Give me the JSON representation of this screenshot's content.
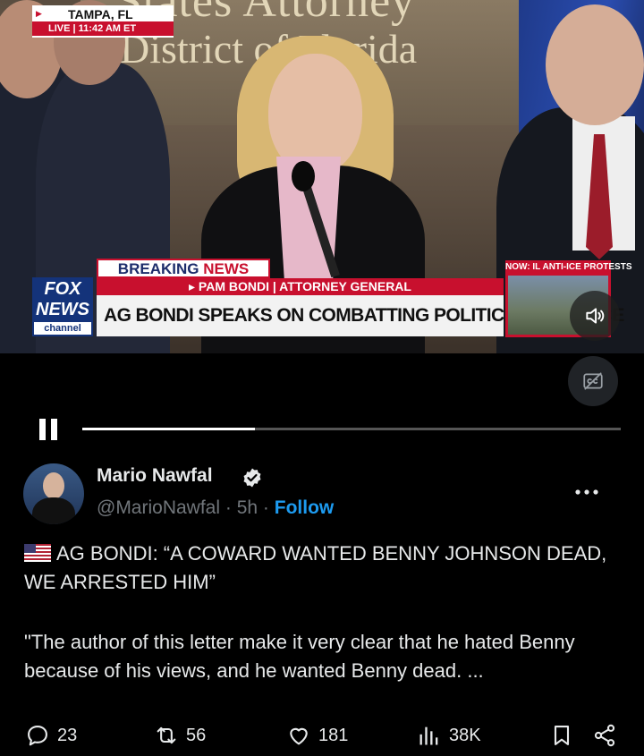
{
  "video": {
    "backdrop_line1": "States Attorney",
    "backdrop_line2": "District of Florida",
    "location": {
      "city": "TAMPA, FL",
      "live": "LIVE",
      "time": "11:42 AM ET"
    },
    "breaking": {
      "word1": "BREAKING",
      "word2": "NEWS"
    },
    "name_bar": "▸ PAM BONDI | ATTORNEY GENERAL",
    "headline": "AG BONDI SPEAKS ON COMBATTING POLITICAL VIOLENCE",
    "network": {
      "line1": "FOX",
      "line2": "NEWS",
      "channel": "channel"
    },
    "now_box": "NOW: IL ANTI-ICE PROTESTS",
    "progress": 0.32,
    "icons": {
      "volume": "volume-icon",
      "captions": "captions-off-icon",
      "pause": "pause-icon"
    }
  },
  "post": {
    "author": "Mario Nawfal",
    "handle": "@MarioNawfal",
    "sep": "·",
    "age": "5h",
    "follow": "Follow",
    "headline_text": "AG  BONDI: “A COWARD WANTED BENNY JOHNSON DEAD, WE ARRESTED HIM”",
    "body_text": "\"The author of this letter make it very clear that he hated Benny because of his views, and he wanted Benny dead. ..."
  },
  "actions": {
    "replies": "23",
    "reposts": "56",
    "likes": "181",
    "views": "38K"
  },
  "colors": {
    "accent": "#1d9bf0",
    "fox_red": "#c8102e",
    "fox_blue": "#14337a"
  }
}
